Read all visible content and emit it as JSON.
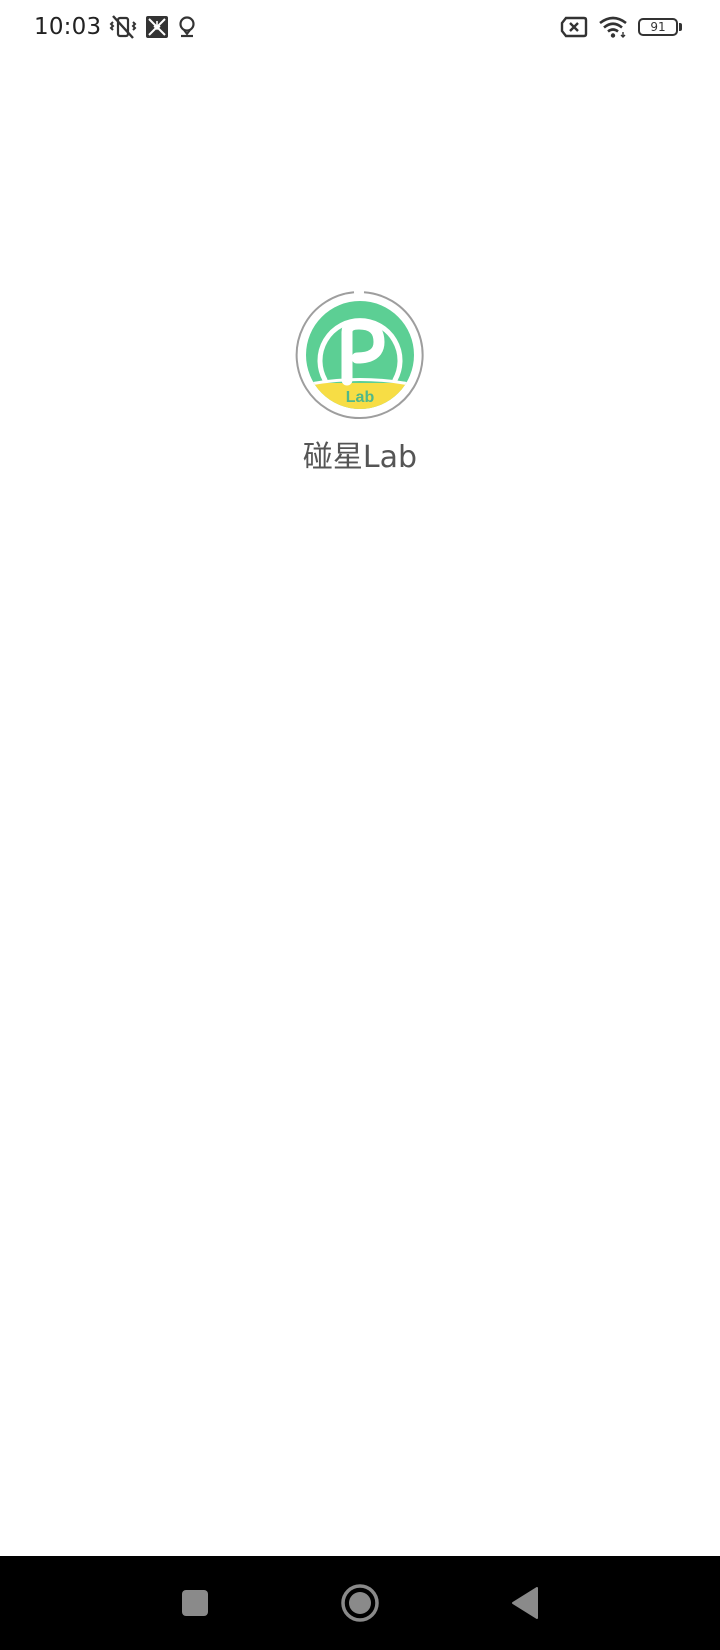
{
  "status_bar": {
    "time": "10:03",
    "battery_level": "91",
    "left_icons": [
      "vibrate-off-icon",
      "screenshot-notification-icon",
      "location-pin-icon"
    ],
    "right_icons": [
      "no-sim-icon",
      "wifi-icon",
      "battery-icon"
    ]
  },
  "splash": {
    "app_name": "碰星Lab",
    "logo_badge_text": "Lab",
    "colors": {
      "logo_green": "#5ccf94",
      "logo_yellow": "#f7dd45",
      "ring_gray": "#9e9e9e"
    }
  },
  "nav_bar": {
    "buttons": [
      "recents-button",
      "home-button",
      "back-button"
    ],
    "color": "#000000",
    "icon_color": "#8a8a8a"
  }
}
